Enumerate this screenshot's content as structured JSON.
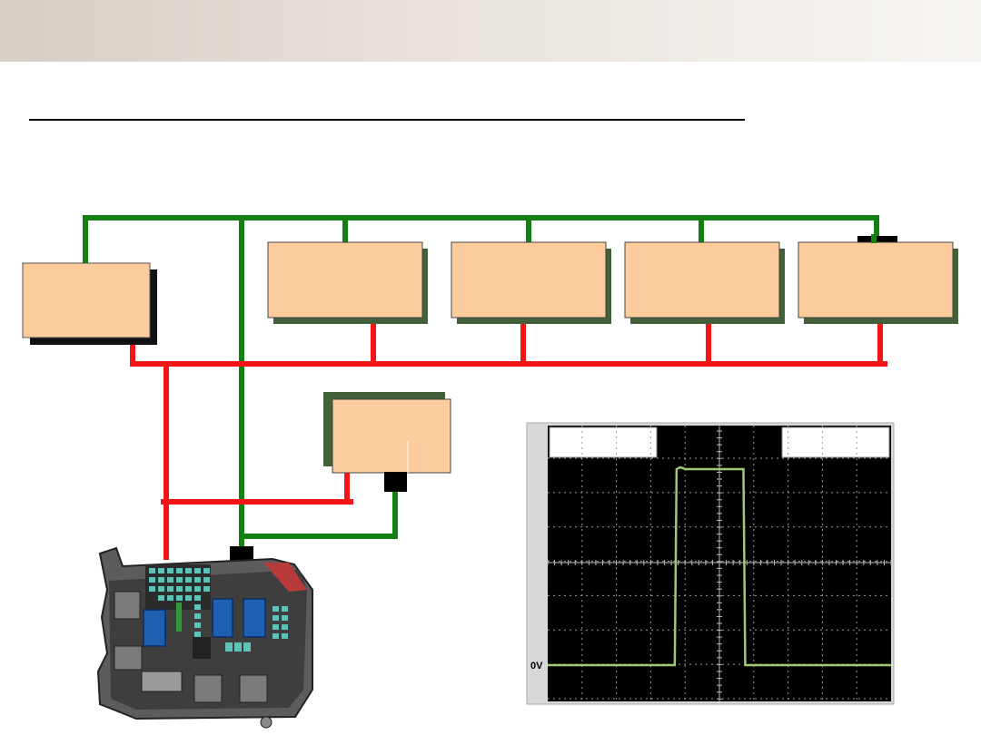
{
  "colors": {
    "module_fill": "#fdcc9c",
    "shadow_dark": "#111111",
    "shadow_green": "#42603a",
    "bus_green": "#128012",
    "bus_red": "#f41616",
    "scope_background": "#000000",
    "trace": "#9ccb74",
    "grid": "#bbbbbb"
  },
  "oscilloscope": {
    "zero_label": "0V",
    "pulse": {
      "baseline_level": 0,
      "high_level_divisions": 6,
      "rise_division": 3.7,
      "fall_division": 5.7,
      "total_divisions": 10
    }
  },
  "icons": {
    "fuse_box": "fuse-box-icon",
    "connector_top": "connector-block-icon",
    "connector_bottom": "connector-block-icon"
  }
}
